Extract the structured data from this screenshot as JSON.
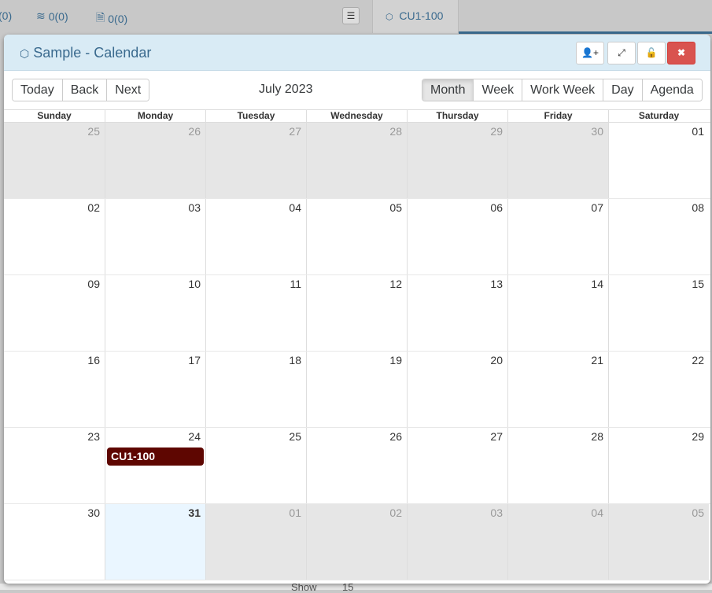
{
  "topbar": {
    "stat1": "(0)",
    "stat2": "0(0)",
    "stat3": "0(0)",
    "tab_label": "CU1-100"
  },
  "background": {
    "show_label": "Show",
    "page_size": "15"
  },
  "modal": {
    "title": "Sample - Calendar"
  },
  "toolbar": {
    "nav": [
      "Today",
      "Back",
      "Next"
    ],
    "label": "July 2023",
    "views": [
      "Month",
      "Week",
      "Work Week",
      "Day",
      "Agenda"
    ],
    "active_view": "Month"
  },
  "calendar": {
    "weekdays": [
      "Sunday",
      "Monday",
      "Tuesday",
      "Wednesday",
      "Thursday",
      "Friday",
      "Saturday"
    ],
    "weeks": [
      [
        {
          "d": "25",
          "t": "off"
        },
        {
          "d": "26",
          "t": "off"
        },
        {
          "d": "27",
          "t": "off"
        },
        {
          "d": "28",
          "t": "off"
        },
        {
          "d": "29",
          "t": "off"
        },
        {
          "d": "30",
          "t": "off"
        },
        {
          "d": "01",
          "t": "cur"
        }
      ],
      [
        {
          "d": "02",
          "t": "cur"
        },
        {
          "d": "03",
          "t": "cur"
        },
        {
          "d": "04",
          "t": "cur"
        },
        {
          "d": "05",
          "t": "cur"
        },
        {
          "d": "06",
          "t": "cur"
        },
        {
          "d": "07",
          "t": "cur"
        },
        {
          "d": "08",
          "t": "cur"
        }
      ],
      [
        {
          "d": "09",
          "t": "cur"
        },
        {
          "d": "10",
          "t": "cur"
        },
        {
          "d": "11",
          "t": "cur"
        },
        {
          "d": "12",
          "t": "cur"
        },
        {
          "d": "13",
          "t": "cur"
        },
        {
          "d": "14",
          "t": "cur"
        },
        {
          "d": "15",
          "t": "cur"
        }
      ],
      [
        {
          "d": "16",
          "t": "cur"
        },
        {
          "d": "17",
          "t": "cur"
        },
        {
          "d": "18",
          "t": "cur"
        },
        {
          "d": "19",
          "t": "cur"
        },
        {
          "d": "20",
          "t": "cur"
        },
        {
          "d": "21",
          "t": "cur"
        },
        {
          "d": "22",
          "t": "cur"
        }
      ],
      [
        {
          "d": "23",
          "t": "cur"
        },
        {
          "d": "24",
          "t": "cur",
          "event": "CU1-100"
        },
        {
          "d": "25",
          "t": "cur"
        },
        {
          "d": "26",
          "t": "cur"
        },
        {
          "d": "27",
          "t": "cur"
        },
        {
          "d": "28",
          "t": "cur"
        },
        {
          "d": "29",
          "t": "cur"
        }
      ],
      [
        {
          "d": "30",
          "t": "cur"
        },
        {
          "d": "31",
          "t": "today"
        },
        {
          "d": "01",
          "t": "off"
        },
        {
          "d": "02",
          "t": "off"
        },
        {
          "d": "03",
          "t": "off"
        },
        {
          "d": "04",
          "t": "off"
        },
        {
          "d": "05",
          "t": "off"
        }
      ]
    ]
  },
  "colors": {
    "event": "#5e0601",
    "header": "#d9ebf5",
    "close": "#d9534f",
    "today": "#eaf6ff"
  }
}
